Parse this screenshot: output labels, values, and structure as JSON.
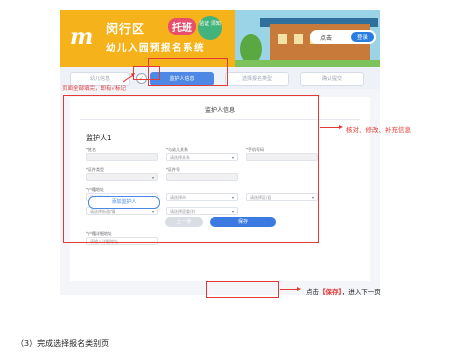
{
  "banner": {
    "logo": "m",
    "title_part1": "闵行区",
    "title_tag": "托班",
    "bubble_text": "验证 须知",
    "subtitle": "幼儿入园预报名系统",
    "login_label": "点击",
    "login_button": "登录"
  },
  "steps": [
    {
      "label": "幼儿信息",
      "active": false
    },
    {
      "label": "监护人信息",
      "active": true
    },
    {
      "label": "选择报名类型",
      "active": false
    },
    {
      "label": "确认提交",
      "active": false
    }
  ],
  "step_icon": "check-circle-icon",
  "form": {
    "card_title": "监护人信息",
    "section_title": "监护人1",
    "fields": {
      "name": {
        "label": "*姓名",
        "value": ""
      },
      "relation": {
        "label": "*与幼儿关系",
        "value": "请选择关系"
      },
      "phone": {
        "label": "*手机号码",
        "value": ""
      },
      "idtype": {
        "label": "*证件类型",
        "value": ""
      },
      "idnum": {
        "label": "*证件号",
        "value": ""
      },
      "household": {
        "label": "*户籍地址",
        "value": ""
      },
      "addr_sel1": "请选择省份",
      "addr_sel2": "请选择市",
      "addr_sel3": "请选择区/县",
      "addr_sel4": "请选择街道/镇",
      "addr_sel5": "请选择居委/村",
      "detail": {
        "label": "*户籍详细地址",
        "placeholder": "请输入详细地址"
      }
    },
    "add_guardian": "添加监护人",
    "prev_button": "上一步",
    "save_button": "保存"
  },
  "annotations": {
    "step_note": "页面全部填完，即有√标记",
    "verify_note": "核对、修改、补充信息",
    "save_note_prefix": "点击",
    "save_note_key": "【保存】",
    "save_note_suffix": "，进入下一页"
  },
  "caption": "（3）完成选择报名类别页",
  "colors": {
    "accent": "#3b7ae0",
    "annotation": "#e53935",
    "banner": "#f6b21b"
  }
}
